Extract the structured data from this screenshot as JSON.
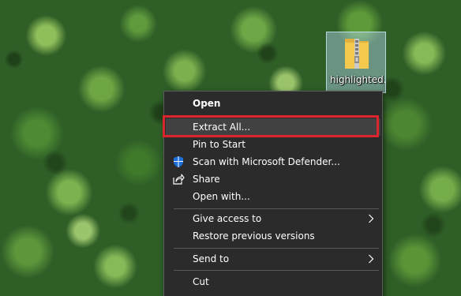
{
  "desktop": {
    "icon": {
      "label": "highlighted.zi",
      "icon_name": "zip-folder-icon"
    }
  },
  "context_menu": {
    "items": [
      {
        "id": "open",
        "label": "Open",
        "bold": true
      },
      {
        "id": "extract-all",
        "label": "Extract All...",
        "highlighted": true
      },
      {
        "id": "pin-to-start",
        "label": "Pin to Start"
      },
      {
        "id": "scan-defender",
        "label": "Scan with Microsoft Defender...",
        "icon": "defender-shield-icon"
      },
      {
        "id": "share",
        "label": "Share",
        "icon": "share-icon"
      },
      {
        "id": "open-with",
        "label": "Open with..."
      },
      {
        "id": "give-access",
        "label": "Give access to",
        "submenu": true
      },
      {
        "id": "restore-versions",
        "label": "Restore previous versions"
      },
      {
        "id": "send-to",
        "label": "Send to",
        "submenu": true
      },
      {
        "id": "cut",
        "label": "Cut"
      }
    ]
  },
  "colors": {
    "menu_background": "#2b2b2b",
    "menu_highlight": "#414141",
    "annotation": "#d9252b",
    "defender_blue": "#1e6fd9",
    "zip_yellow": "#f2c94c"
  }
}
